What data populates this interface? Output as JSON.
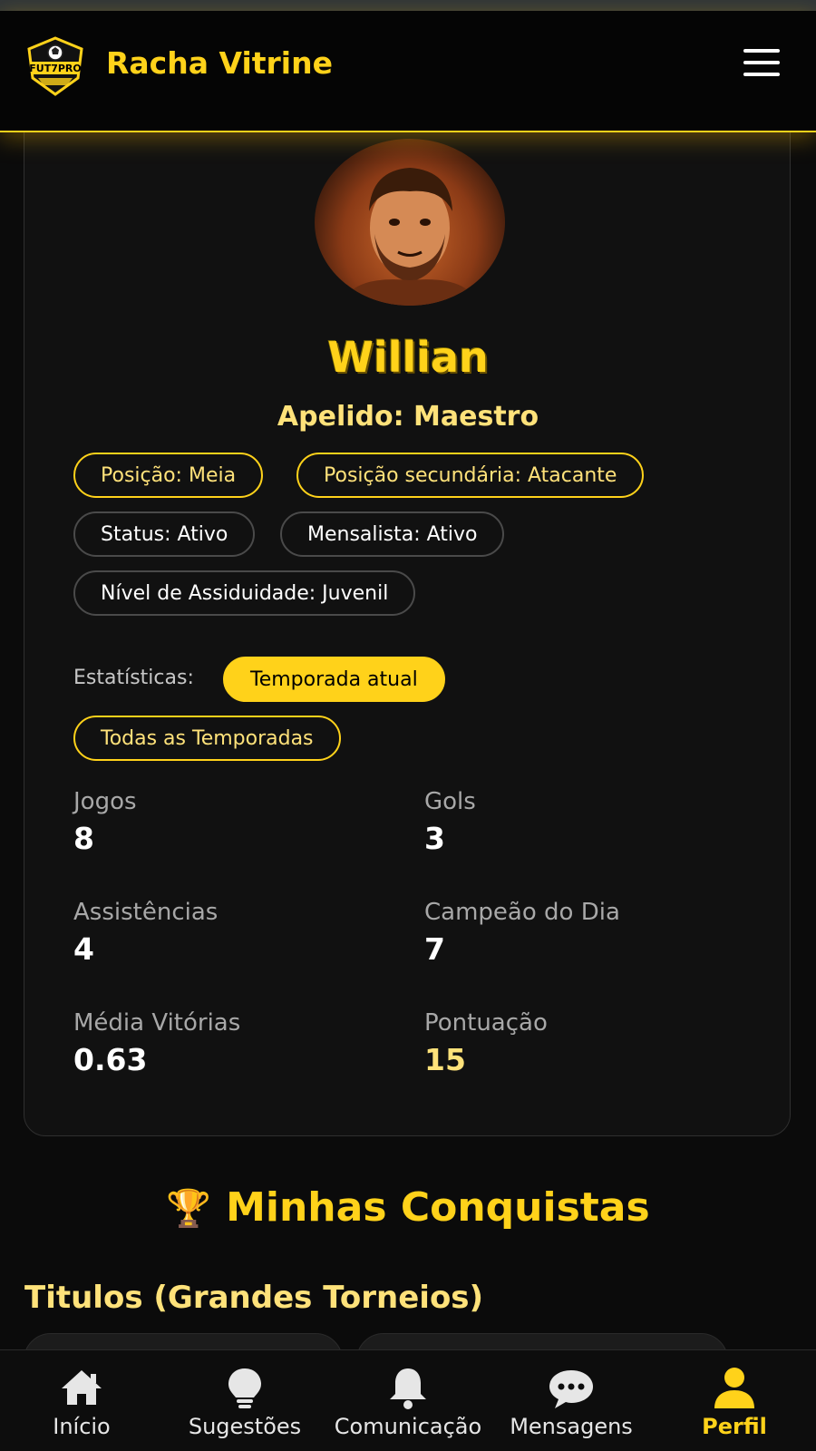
{
  "header": {
    "logo_text": "FUT7PRO",
    "brand_title": "Racha Vitrine"
  },
  "profile": {
    "name": "Willian",
    "nickname_label": "Apelido: Maestro",
    "tags": {
      "position": "Posição: Meia",
      "secondary_position": "Posição secundária: Atacante",
      "status": "Status: Ativo",
      "monthly": "Mensalista: Ativo",
      "attendance": "Nível de Assiduidade: Juvenil"
    },
    "stats_label": "Estatísticas:",
    "stats_filters": {
      "current_season": "Temporada atual",
      "all_seasons": "Todas as Temporadas",
      "selected": "current_season"
    },
    "stats": [
      {
        "label": "Jogos",
        "value": "8"
      },
      {
        "label": "Gols",
        "value": "3"
      },
      {
        "label": "Assistências",
        "value": "4"
      },
      {
        "label": "Campeão do Dia",
        "value": "7"
      },
      {
        "label": "Média Vitórias",
        "value": "0.63"
      },
      {
        "label": "Pontuação",
        "value": "15"
      }
    ]
  },
  "achievements": {
    "title": "Minhas Conquistas",
    "titles_heading": "Titulos (Grandes Torneios)"
  },
  "bottom_nav": [
    {
      "label": "Início",
      "icon": "home-icon"
    },
    {
      "label": "Sugestões",
      "icon": "lightbulb-icon"
    },
    {
      "label": "Comunicação",
      "icon": "bell-icon"
    },
    {
      "label": "Mensagens",
      "icon": "chat-icon"
    },
    {
      "label": "Perfil",
      "icon": "user-icon",
      "active": true
    }
  ],
  "colors": {
    "accent": "#ffd21a",
    "accent_light": "#ffe27a",
    "background": "#0b0b0b",
    "card": "#111111"
  }
}
